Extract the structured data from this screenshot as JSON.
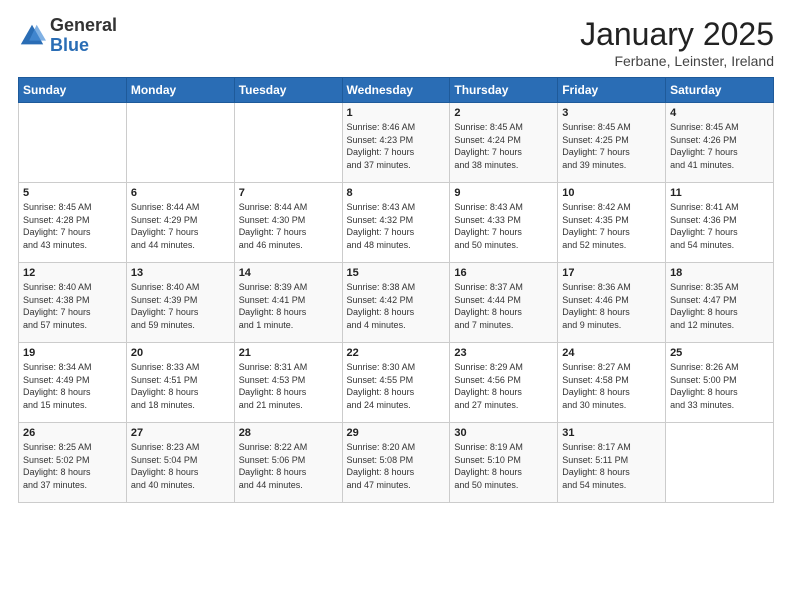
{
  "logo": {
    "general": "General",
    "blue": "Blue"
  },
  "header": {
    "title": "January 2025",
    "subtitle": "Ferbane, Leinster, Ireland"
  },
  "days_of_week": [
    "Sunday",
    "Monday",
    "Tuesday",
    "Wednesday",
    "Thursday",
    "Friday",
    "Saturday"
  ],
  "weeks": [
    [
      {
        "day": "",
        "info": ""
      },
      {
        "day": "",
        "info": ""
      },
      {
        "day": "",
        "info": ""
      },
      {
        "day": "1",
        "info": "Sunrise: 8:46 AM\nSunset: 4:23 PM\nDaylight: 7 hours\nand 37 minutes."
      },
      {
        "day": "2",
        "info": "Sunrise: 8:45 AM\nSunset: 4:24 PM\nDaylight: 7 hours\nand 38 minutes."
      },
      {
        "day": "3",
        "info": "Sunrise: 8:45 AM\nSunset: 4:25 PM\nDaylight: 7 hours\nand 39 minutes."
      },
      {
        "day": "4",
        "info": "Sunrise: 8:45 AM\nSunset: 4:26 PM\nDaylight: 7 hours\nand 41 minutes."
      }
    ],
    [
      {
        "day": "5",
        "info": "Sunrise: 8:45 AM\nSunset: 4:28 PM\nDaylight: 7 hours\nand 43 minutes."
      },
      {
        "day": "6",
        "info": "Sunrise: 8:44 AM\nSunset: 4:29 PM\nDaylight: 7 hours\nand 44 minutes."
      },
      {
        "day": "7",
        "info": "Sunrise: 8:44 AM\nSunset: 4:30 PM\nDaylight: 7 hours\nand 46 minutes."
      },
      {
        "day": "8",
        "info": "Sunrise: 8:43 AM\nSunset: 4:32 PM\nDaylight: 7 hours\nand 48 minutes."
      },
      {
        "day": "9",
        "info": "Sunrise: 8:43 AM\nSunset: 4:33 PM\nDaylight: 7 hours\nand 50 minutes."
      },
      {
        "day": "10",
        "info": "Sunrise: 8:42 AM\nSunset: 4:35 PM\nDaylight: 7 hours\nand 52 minutes."
      },
      {
        "day": "11",
        "info": "Sunrise: 8:41 AM\nSunset: 4:36 PM\nDaylight: 7 hours\nand 54 minutes."
      }
    ],
    [
      {
        "day": "12",
        "info": "Sunrise: 8:40 AM\nSunset: 4:38 PM\nDaylight: 7 hours\nand 57 minutes."
      },
      {
        "day": "13",
        "info": "Sunrise: 8:40 AM\nSunset: 4:39 PM\nDaylight: 7 hours\nand 59 minutes."
      },
      {
        "day": "14",
        "info": "Sunrise: 8:39 AM\nSunset: 4:41 PM\nDaylight: 8 hours\nand 1 minute."
      },
      {
        "day": "15",
        "info": "Sunrise: 8:38 AM\nSunset: 4:42 PM\nDaylight: 8 hours\nand 4 minutes."
      },
      {
        "day": "16",
        "info": "Sunrise: 8:37 AM\nSunset: 4:44 PM\nDaylight: 8 hours\nand 7 minutes."
      },
      {
        "day": "17",
        "info": "Sunrise: 8:36 AM\nSunset: 4:46 PM\nDaylight: 8 hours\nand 9 minutes."
      },
      {
        "day": "18",
        "info": "Sunrise: 8:35 AM\nSunset: 4:47 PM\nDaylight: 8 hours\nand 12 minutes."
      }
    ],
    [
      {
        "day": "19",
        "info": "Sunrise: 8:34 AM\nSunset: 4:49 PM\nDaylight: 8 hours\nand 15 minutes."
      },
      {
        "day": "20",
        "info": "Sunrise: 8:33 AM\nSunset: 4:51 PM\nDaylight: 8 hours\nand 18 minutes."
      },
      {
        "day": "21",
        "info": "Sunrise: 8:31 AM\nSunset: 4:53 PM\nDaylight: 8 hours\nand 21 minutes."
      },
      {
        "day": "22",
        "info": "Sunrise: 8:30 AM\nSunset: 4:55 PM\nDaylight: 8 hours\nand 24 minutes."
      },
      {
        "day": "23",
        "info": "Sunrise: 8:29 AM\nSunset: 4:56 PM\nDaylight: 8 hours\nand 27 minutes."
      },
      {
        "day": "24",
        "info": "Sunrise: 8:27 AM\nSunset: 4:58 PM\nDaylight: 8 hours\nand 30 minutes."
      },
      {
        "day": "25",
        "info": "Sunrise: 8:26 AM\nSunset: 5:00 PM\nDaylight: 8 hours\nand 33 minutes."
      }
    ],
    [
      {
        "day": "26",
        "info": "Sunrise: 8:25 AM\nSunset: 5:02 PM\nDaylight: 8 hours\nand 37 minutes."
      },
      {
        "day": "27",
        "info": "Sunrise: 8:23 AM\nSunset: 5:04 PM\nDaylight: 8 hours\nand 40 minutes."
      },
      {
        "day": "28",
        "info": "Sunrise: 8:22 AM\nSunset: 5:06 PM\nDaylight: 8 hours\nand 44 minutes."
      },
      {
        "day": "29",
        "info": "Sunrise: 8:20 AM\nSunset: 5:08 PM\nDaylight: 8 hours\nand 47 minutes."
      },
      {
        "day": "30",
        "info": "Sunrise: 8:19 AM\nSunset: 5:10 PM\nDaylight: 8 hours\nand 50 minutes."
      },
      {
        "day": "31",
        "info": "Sunrise: 8:17 AM\nSunset: 5:11 PM\nDaylight: 8 hours\nand 54 minutes."
      },
      {
        "day": "",
        "info": ""
      }
    ]
  ]
}
